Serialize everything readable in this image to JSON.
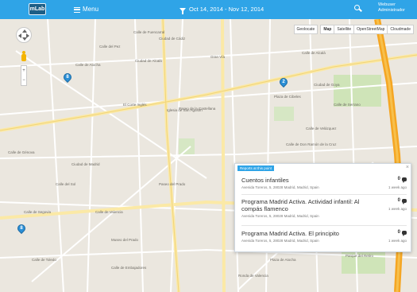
{
  "header": {
    "logo_text": "mLab",
    "menu_label": "Menu",
    "date_range": "Oct 14, 2014 - Nov 12, 2014",
    "user_name": "Webuser",
    "user_role": "Administrador"
  },
  "map": {
    "geolocate_label": "Geolocate",
    "types": [
      "Map",
      "Satellite",
      "OpenStreetMap",
      "Cloudmade"
    ],
    "active_type": "Map",
    "zoom_in": "+",
    "zoom_out": "−",
    "markers": [
      "8",
      "2",
      "8",
      "3"
    ],
    "streets": [
      "Calle de Fuencarral",
      "Ciudad de Cádiz",
      "Calle del Pez",
      "Calle de Atocha",
      "Ciudad de Alcalá",
      "Gran Vía",
      "Paseo de la Castellana",
      "Plaza de Cibeles",
      "El Corte Inglés",
      "Iglesia de San Agustín",
      "Calle de Alcalá",
      "Calle de Serrano",
      "Calle de Velázquez",
      "Paseo del Prado",
      "Calle de Segovia",
      "Calle del Sol",
      "Museo del Prado",
      "Calle de Valencia",
      "Calle de Embajadores",
      "Ronda de Valencia",
      "Parque del Retiro",
      "Calle de Toledo",
      "Plaza de Atocha",
      "Calle de Don Ramón de la Cruz",
      "Ciudad de Goya",
      "Calle de Génova",
      "Ciudad de Madrid"
    ]
  },
  "popup": {
    "tag": "Reports at this point",
    "close": "×",
    "reports": [
      {
        "title": "Cuentos infantiles",
        "address": "Avenida Toreros, 5, 28028 Madrid, Madrid, Spain",
        "count": "0",
        "ago": "1 week ago"
      },
      {
        "title": "Programa Madrid Activa. Actividad infantil: Al compás flamenco",
        "address": "Avenida Toreros, 5, 28028 Madrid, Madrid, Spain",
        "count": "0",
        "ago": "1 week ago"
      },
      {
        "title": "Programa Madrid Activa. El principito",
        "address": "Avenida Toreros, 5, 28028 Madrid, Madrid, Spain",
        "count": "0",
        "ago": "1 week ago"
      }
    ]
  }
}
